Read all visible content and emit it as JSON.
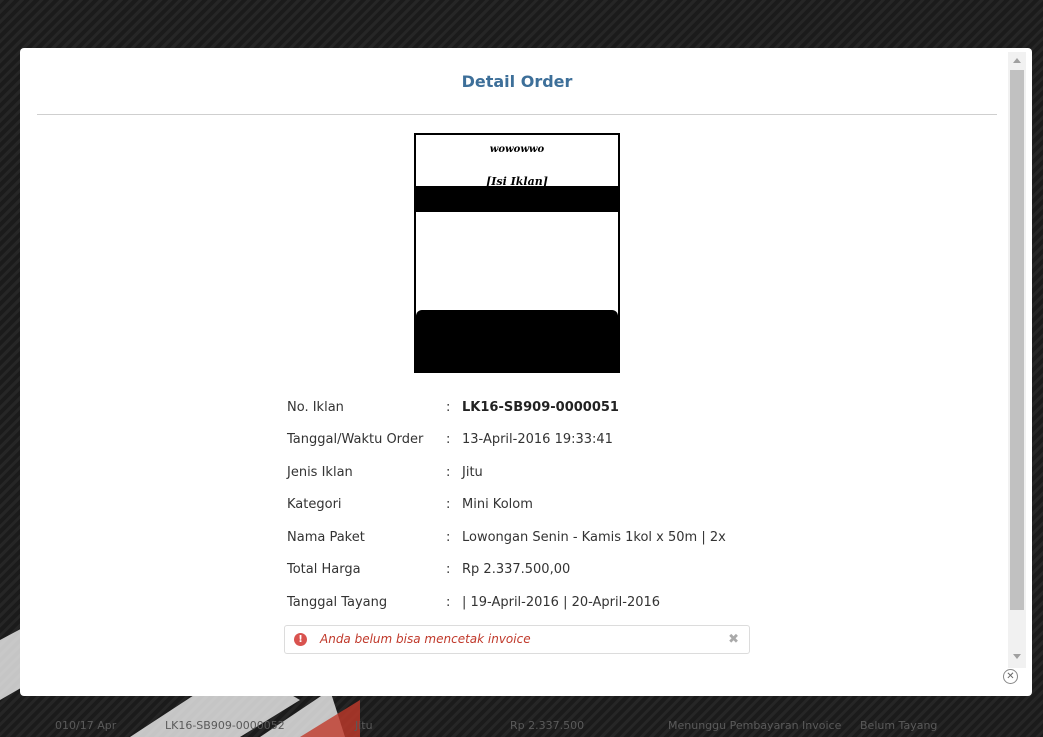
{
  "modal": {
    "title": "Detail Order",
    "preview": {
      "line1": "wowowwo",
      "line2": "[Isi Iklan]"
    },
    "details": [
      {
        "label": "No. Iklan",
        "value": "LK16-SB909-0000051",
        "bold": true
      },
      {
        "label": "Tanggal/Waktu Order",
        "value": "13-April-2016 19:33:41"
      },
      {
        "label": "Jenis Iklan",
        "value": "Jitu"
      },
      {
        "label": "Kategori",
        "value": "Mini Kolom"
      },
      {
        "label": "Nama Paket",
        "value": "Lowongan Senin - Kamis 1kol x 50m | 2x"
      },
      {
        "label": "Total Harga",
        "value": "Rp 2.337.500,00"
      },
      {
        "label": "Tanggal Tayang",
        "value": "| 19-April-2016 | 20-April-2016"
      }
    ],
    "colon": ":",
    "alert": {
      "icon": "exclamation-circle-icon",
      "text": "Anda belum bisa mencetak invoice",
      "close_icon": "close-x-icon"
    },
    "close_icon": "circle-close-icon"
  },
  "background": {
    "row_cells": [
      "010/17 Apr",
      "LK16-SB909-0000052",
      "Jitu",
      "Rp 2.337.500",
      "Menunggu Pembayaran Invoice",
      "Belum Tayang"
    ]
  },
  "colors": {
    "title": "#3d6f99",
    "alert_text": "#c0392b",
    "alert_icon": "#d9534f",
    "watermark": "#c0392b"
  }
}
